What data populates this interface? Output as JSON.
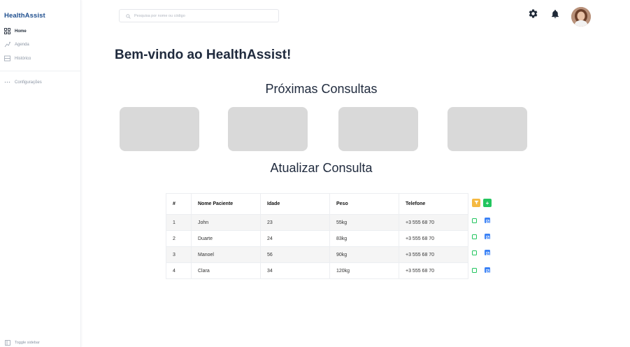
{
  "sidebar": {
    "brand": "HealthAssist",
    "items": [
      {
        "label": "Home",
        "icon": "grid-icon"
      },
      {
        "label": "Agenda",
        "icon": "calendar-icon"
      },
      {
        "label": "Histórico",
        "icon": "history-icon"
      },
      {
        "label": "Configurações",
        "icon": "dots-icon"
      }
    ],
    "toggle_label": "Toggle sidebar"
  },
  "topbar": {
    "search_placeholder": "Pesquisa por nome ou código"
  },
  "main": {
    "welcome": "Bem-vindo ao HealthAssist!",
    "upcoming_title": "Próximas Consultas",
    "update_title": "Atualizar Consulta"
  },
  "table": {
    "headers": [
      "#",
      "Nome Paciente",
      "Idade",
      "Peso",
      "Telefone"
    ],
    "rows": [
      {
        "num": "1",
        "name": "John",
        "age": "23",
        "peso": "55kg",
        "tel": "+3 555 68 70"
      },
      {
        "num": "2",
        "name": "Duarte",
        "age": "24",
        "peso": "83kg",
        "tel": "+3 555 68 70"
      },
      {
        "num": "3",
        "name": "Manoel",
        "age": "56",
        "peso": "90kg",
        "tel": "+3 555 68 70"
      },
      {
        "num": "4",
        "name": "Clara",
        "age": "34",
        "peso": "120kg",
        "tel": "+3 555 68 70"
      }
    ],
    "add_label": "+"
  },
  "colors": {
    "brand": "#1f4f8f",
    "filter": "#f5b942",
    "add": "#22c55e",
    "check": "#22c55e",
    "edit": "#3b82f6",
    "card": "#d9d9d9"
  }
}
